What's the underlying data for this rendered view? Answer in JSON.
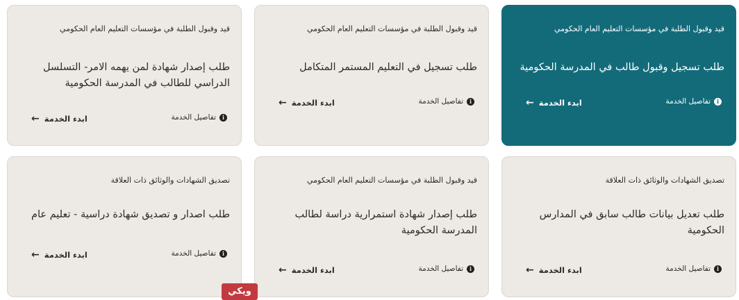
{
  "cards": [
    {
      "category": "قيد وقبول الطلبة في مؤسسات التعليم العام الحكومي",
      "title": "طلب تسجيل وقبول طالب في المدرسة الحكومية",
      "details_label": "تفاصيل الخدمة",
      "start_label": "ابدء الخدمة"
    },
    {
      "category": "قيد وقبول الطلبة في مؤسسات التعليم العام الحكومي",
      "title": "طلب تسجيل في التعليم المستمر المتكامل",
      "details_label": "تفاصيل الخدمة",
      "start_label": "ابدء الخدمة"
    },
    {
      "category": "قيد وقبول الطلبة في مؤسسات التعليم العام الحكومي",
      "title": "طلب إصدار شهادة لمن يهمه الامر- التسلسل الدراسي للطالب في المدرسة الحكومية",
      "details_label": "تفاصيل الخدمة",
      "start_label": "ابدء الخدمة"
    },
    {
      "category": "تصديق الشهادات والوثائق ذات العلاقة",
      "title": "طلب تعديل بيانات طالب سابق في المدارس الحكومية",
      "details_label": "تفاصيل الخدمة",
      "start_label": "ابدء الخدمة"
    },
    {
      "category": "قيد وقبول الطلبة في مؤسسات التعليم العام الحكومي",
      "title": "طلب إصدار شهادة استمرارية دراسة لطالب المدرسة الحكومية",
      "details_label": "تفاصيل الخدمة",
      "start_label": "ابدء الخدمة"
    },
    {
      "category": "تصديق الشهادات والوثائق ذات العلاقة",
      "title": "طلب اصدار و تصديق شهادة دراسية - تعليم عام",
      "details_label": "تفاصيل الخدمة",
      "start_label": "ابدء الخدمة"
    }
  ],
  "icons": {
    "info": "i",
    "arrow": "←"
  },
  "colors": {
    "active_card": "#136b7a",
    "card": "#ede9e4",
    "watermark": "#c23a3f"
  },
  "watermark": "ويكي"
}
